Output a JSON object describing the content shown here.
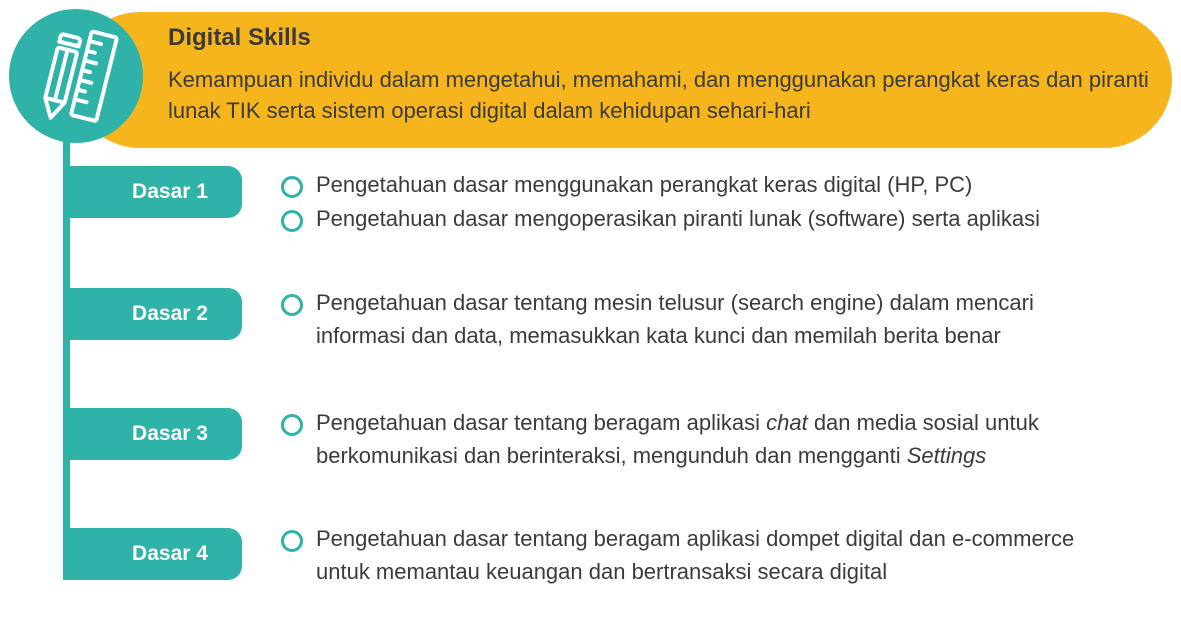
{
  "header": {
    "title": "Digital Skills",
    "description": "Kemampuan individu dalam mengetahui, memahami, dan menggunakan perangkat keras dan piranti lunak TIK serta sistem operasi digital dalam kehidupan sehari-hari",
    "icon": "pencil-ruler-icon",
    "accent_color": "#f6b51c",
    "teal_color": "#2fb2a7"
  },
  "levels": [
    {
      "label": "Dasar 1",
      "items": [
        "Pengetahuan dasar menggunakan perangkat keras digital (HP, PC)",
        "Pengetahuan dasar mengoperasikan piranti lunak (software) serta aplikasi"
      ]
    },
    {
      "label": "Dasar 2",
      "items": [
        "Pengetahuan dasar tentang mesin telusur (search engine) dalam mencari informasi dan data, memasukkan kata kunci dan memilah berita benar"
      ]
    },
    {
      "label": "Dasar 3",
      "items": [
        {
          "pre": "Pengetahuan dasar tentang beragam aplikasi ",
          "em": "chat",
          "mid": " dan media sosial untuk berkomunikasi dan berinteraksi, mengunduh dan mengganti ",
          "em2": "Settings"
        }
      ]
    },
    {
      "label": "Dasar 4",
      "items": [
        "Pengetahuan dasar tentang beragam aplikasi dompet digital dan e-commerce untuk memantau keuangan dan bertransaksi secara digital"
      ]
    }
  ]
}
